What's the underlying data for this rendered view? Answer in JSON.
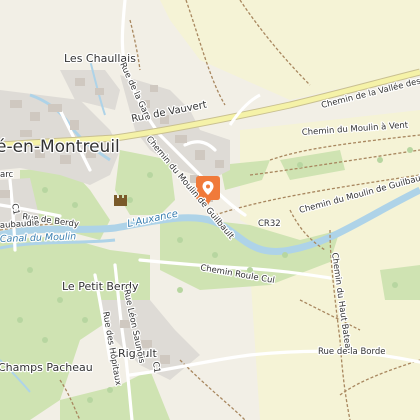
{
  "map": {
    "places": {
      "chaullais": "Les Chaullais",
      "town": "é-en-Montreuil",
      "petit_berdy": "Le Petit Berdy",
      "rigault": "Rigault",
      "champs_pacheau": "Champs Pacheau",
      "arc": "arc"
    },
    "roads": {
      "vauvert": "Rue de Vauvert",
      "gare": "Rue de la Gare",
      "moulin_guilbault": "Chemin du Moulin de Guilbault",
      "moulin_guilbault_2": "Chemin du Moulin de Guilbault",
      "vallee": "Chemin de la Vallée des Br",
      "moulin_vent": "Chemin du Moulin à Vent",
      "roule_cul": "Chemin Roule Cul",
      "haut_bateau": "Chemin du Haut Bateau",
      "leon_saunois": "Rue Léon Saunois",
      "hopitaux": "Rue des Hôpitaux",
      "borde": "Rue de la Borde",
      "berdy": "Rue de Berdy",
      "cr32": "CR32",
      "c1": "C1",
      "c1b": "C1",
      "abaudie": "aubaudie"
    },
    "water": {
      "auxance": "L'Auxance",
      "canal": "Canal du Moulin"
    },
    "marker": {
      "icon": "location-pin-icon",
      "color": "#f07a3a"
    },
    "castle": {
      "icon": "castle-icon"
    },
    "colors": {
      "background": "#f2efe6",
      "field": "#f5f3d6",
      "forest": "#cfe3b2",
      "residential": "#dedbd6",
      "water": "#aed3e8",
      "main_road": "#f5f2a8",
      "road_casing": "#c9c090",
      "track": "#a8875f",
      "building": "#cfc8c0"
    }
  }
}
